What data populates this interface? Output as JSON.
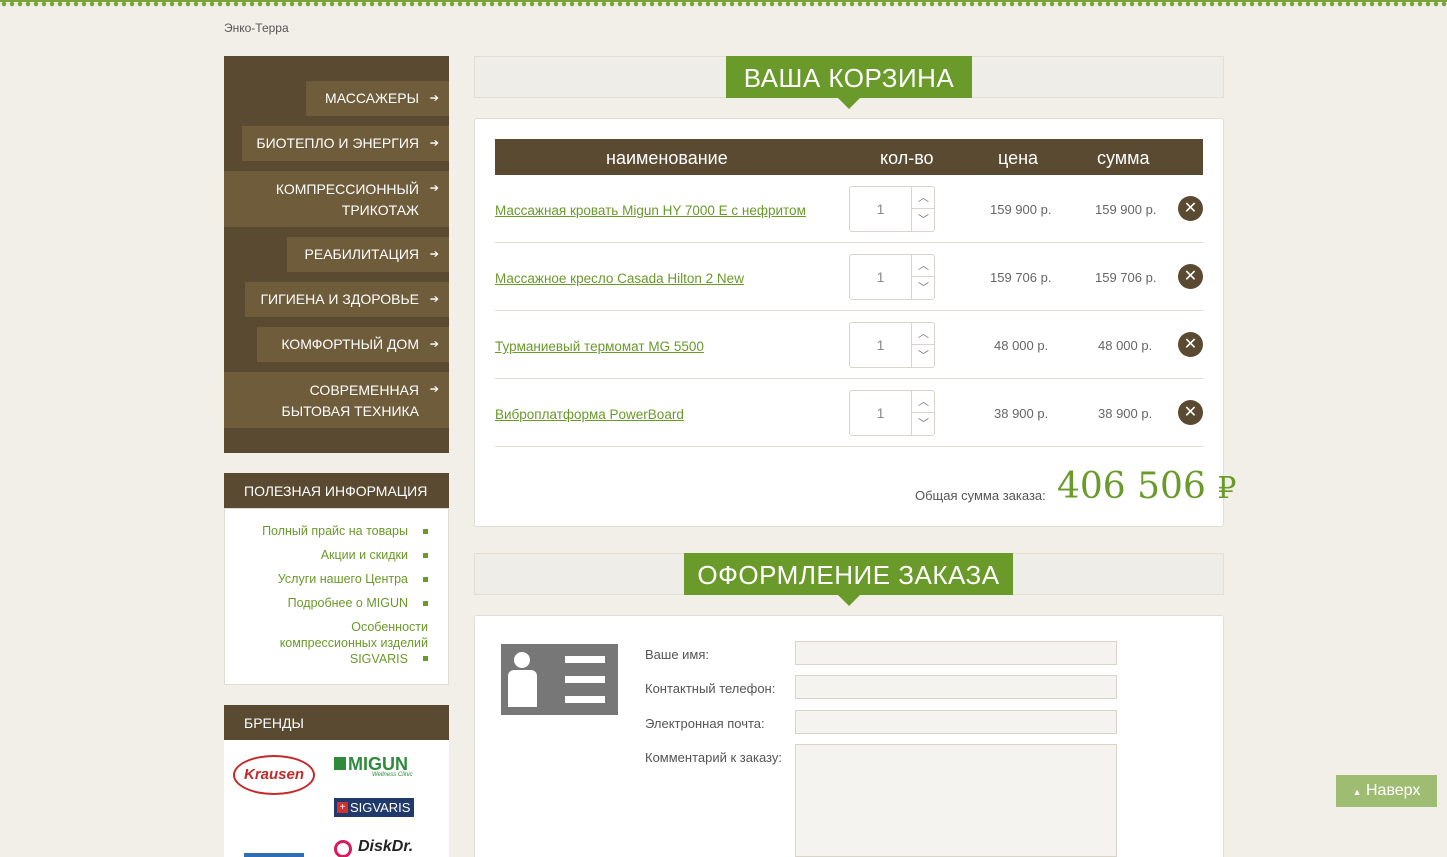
{
  "breadcrumb": "Энко-Терра",
  "menu": [
    {
      "label": "МАССАЖЕРЫ"
    },
    {
      "label": "БИОТЕПЛО И ЭНЕРГИЯ"
    },
    {
      "label_line1": "КОМПРЕССИОННЫЙ",
      "label_line2": "ТРИКОТАЖ"
    },
    {
      "label": "РЕАБИЛИТАЦИЯ"
    },
    {
      "label": "ГИГИЕНА И ЗДОРОВЬЕ"
    },
    {
      "label": "КОМФОРТНЫЙ ДОМ"
    },
    {
      "label_line1": "СОВРЕМЕННАЯ",
      "label_line2": "БЫТОВАЯ ТЕХНИКА"
    }
  ],
  "info": {
    "title": "ПОЛЕЗНАЯ ИНФОРМАЦИЯ",
    "links": [
      "Полный прайс на товары",
      "Акции и скидки",
      "Услуги нашего Центра",
      "Подробнее о MIGUN"
    ],
    "link_multi": [
      "Особенности",
      "компрессионных изделий",
      "SIGVARIS"
    ]
  },
  "brands": {
    "title": "БРЕНДЫ",
    "krausen": "Krausen",
    "migun": "MIGUN",
    "migun_tag": "Wellness Clinic",
    "sigvaris": "SIGVARIS",
    "diskdr": "DiskDr."
  },
  "cart": {
    "title": "ВАША КОРЗИНА",
    "headers": {
      "name": "наименование",
      "qty": "кол-во",
      "price": "цена",
      "sum": "сумма"
    },
    "items": [
      {
        "name": "Массажная кровать Migun HY 7000 E с нефритом",
        "qty": "1",
        "price": "159 900 р.",
        "sum": "159 900 р."
      },
      {
        "name": "Массажное кресло Casada Hilton 2 New",
        "qty": "1",
        "price": "159 706 р.",
        "sum": "159 706 р."
      },
      {
        "name": "Турманиевый термомат MG 5500",
        "qty": "1",
        "price": "48 000 р.",
        "sum": "48 000 р."
      },
      {
        "name": "Виброплатформа PowerBoard",
        "qty": "1",
        "price": "38 900 р.",
        "sum": "38 900 р."
      }
    ],
    "total_label": "Общая сумма заказа:",
    "total_value": "406 506",
    "currency": "₽"
  },
  "order": {
    "title": "ОФОРМЛЕНИЕ ЗАКАЗА",
    "fields": {
      "name": "Ваше имя:",
      "phone": "Контактный телефон:",
      "email": "Электронная почта:",
      "comment": "Комментарий к заказу:"
    }
  },
  "scroll_top": "Наверх",
  "colors": {
    "brown": "#5a4a31",
    "green": "#6a9a2a"
  }
}
